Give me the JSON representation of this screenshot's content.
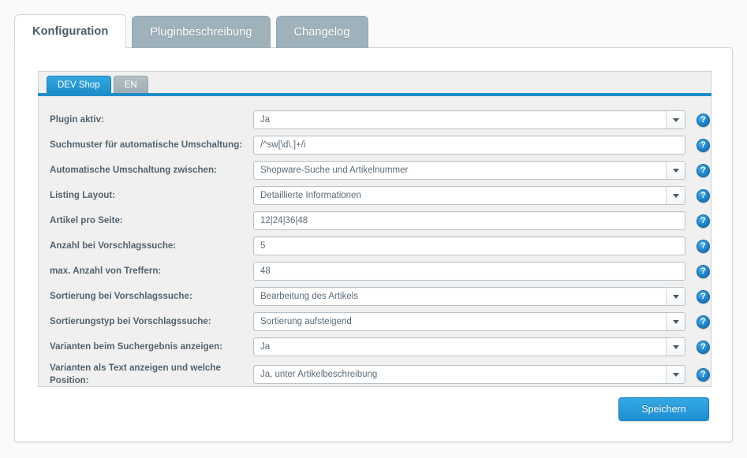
{
  "outer_tabs": [
    {
      "label": "Konfiguration",
      "active": true
    },
    {
      "label": "Pluginbeschreibung",
      "active": false
    },
    {
      "label": "Changelog",
      "active": false
    }
  ],
  "inner_tabs": [
    {
      "label": "DEV Shop",
      "active": true
    },
    {
      "label": "EN",
      "active": false
    }
  ],
  "form": {
    "rows": [
      {
        "label": "Plugin aktiv:",
        "value": "Ja",
        "type": "select"
      },
      {
        "label": "Suchmuster für automatische Umschaltung:",
        "value": "/^sw[\\d\\.]+/i",
        "type": "text"
      },
      {
        "label": "Automatische Umschaltung zwischen:",
        "value": "Shopware-Suche und Artikelnummer",
        "type": "select"
      },
      {
        "label": "Listing Layout:",
        "value": "Detaillierte Informationen",
        "type": "select"
      },
      {
        "label": "Artikel pro Seite:",
        "value": "12|24|36|48",
        "type": "text"
      },
      {
        "label": "Anzahl bei Vorschlagssuche:",
        "value": "5",
        "type": "text"
      },
      {
        "label": "max. Anzahl von Treffern:",
        "value": "48",
        "type": "text"
      },
      {
        "label": "Sortierung bei Vorschlagssuche:",
        "value": "Bearbeitung des Artikels",
        "type": "select"
      },
      {
        "label": "Sortierungstyp bei Vorschlagssuche:",
        "value": "Sortierung aufsteigend",
        "type": "select"
      },
      {
        "label": "Varianten beim Suchergebnis anzeigen:",
        "value": "Ja",
        "type": "select"
      },
      {
        "label": "Varianten als Text anzeigen und welche Position:",
        "value": "Ja, unter Artikelbeschreibung",
        "type": "select"
      }
    ],
    "help_glyph": "?"
  },
  "footer": {
    "save_label": "Speichern"
  },
  "colors": {
    "accent": "#1f8ecb",
    "tab_inactive": "#9fb1bb",
    "panel_bg": "#f0f0f0",
    "label_text": "#55636d"
  }
}
